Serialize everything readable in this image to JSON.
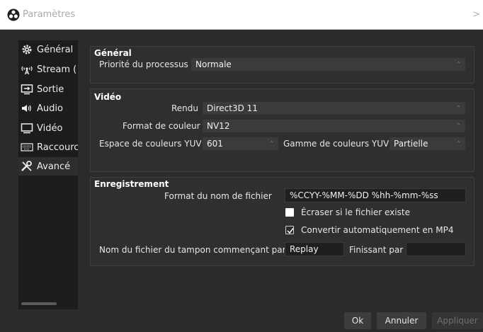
{
  "window": {
    "title": "Paramètres",
    "close_glyph": ">"
  },
  "sidebar": {
    "items": [
      {
        "label": "Général",
        "icon": "gear-icon"
      },
      {
        "label": "Stream (",
        "icon": "broadcast-icon"
      },
      {
        "label": "Sortie",
        "icon": "output-icon"
      },
      {
        "label": "Audio",
        "icon": "speaker-icon"
      },
      {
        "label": "Vidéo",
        "icon": "monitor-icon"
      },
      {
        "label": "Raccourc",
        "icon": "keyboard-icon"
      },
      {
        "label": "Avancé",
        "icon": "tools-icon"
      }
    ],
    "active_index": 6
  },
  "general": {
    "title": "Général",
    "process_priority_label": "Priorité du processus",
    "process_priority_value": "Normale"
  },
  "video": {
    "title": "Vidéo",
    "renderer_label": "Rendu",
    "renderer_value": "Direct3D 11",
    "color_format_label": "Format de couleur",
    "color_format_value": "NV12",
    "yuv_space_label": "Espace de couleurs YUV",
    "yuv_space_value": "601",
    "yuv_range_label": "Gamme de couleurs YUV",
    "yuv_range_value": "Partielle"
  },
  "recording": {
    "title": "Enregistrement",
    "filename_format_label": "Format du nom de fichier",
    "filename_format_value": "%CCYY-%MM-%DD %hh-%mm-%ss",
    "overwrite_label": "Écraser si le fichier existe",
    "overwrite_checked": false,
    "auto_remux_label": "Convertir automatiquement en MP4",
    "auto_remux_checked": true,
    "replay_prefix_label": "Nom du fichier du tampon commençant par",
    "replay_prefix_value": "Replay",
    "replay_suffix_label": "Finissant par",
    "replay_suffix_value": ""
  },
  "buttons": {
    "ok": "Ok",
    "cancel": "Annuler",
    "apply": "Appliquer"
  },
  "colors": {
    "background": "#2b2b2b",
    "sidebar": "#1c1c1c",
    "field": "#3b3b3b",
    "textbox": "#1f1f1f"
  }
}
